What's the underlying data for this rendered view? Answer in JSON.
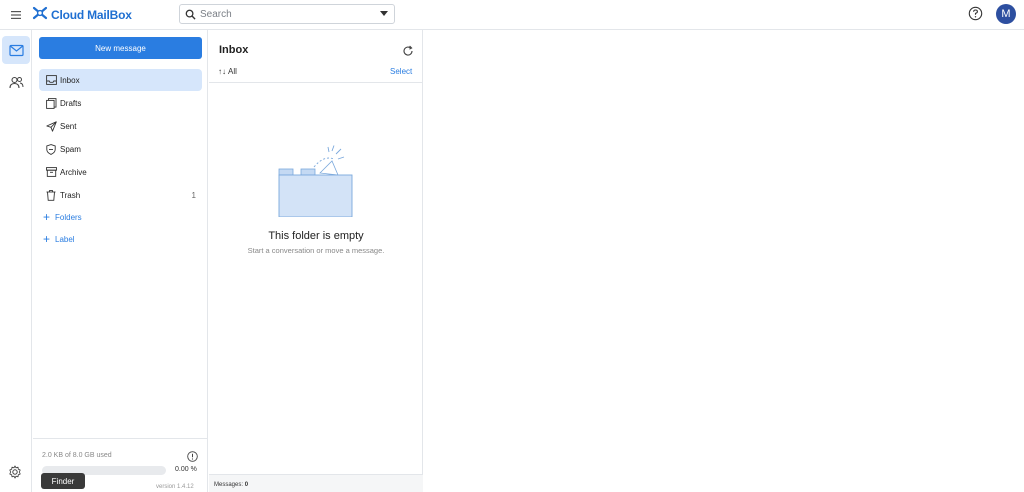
{
  "app": {
    "brand": "Cloud MailBox",
    "accent_color": "#2a7de1",
    "avatar_initial": "M"
  },
  "header": {
    "search_placeholder": "Search",
    "icons": [
      "menu-icon",
      "search-icon",
      "chevron-down-icon",
      "help-icon"
    ]
  },
  "rail": {
    "items": [
      {
        "name": "mail",
        "icon": "envelope-icon",
        "active": true
      },
      {
        "name": "contacts",
        "icon": "people-icon",
        "active": false
      }
    ]
  },
  "sidebar": {
    "new_message_label": "New message",
    "folders": [
      {
        "label": "Inbox",
        "icon": "inbox-icon",
        "count": "",
        "active": true
      },
      {
        "label": "Drafts",
        "icon": "drafts-icon",
        "count": ""
      },
      {
        "label": "Sent",
        "icon": "send-icon",
        "count": ""
      },
      {
        "label": "Spam",
        "icon": "shield-icon",
        "count": ""
      },
      {
        "label": "Archive",
        "icon": "archive-icon",
        "count": ""
      },
      {
        "label": "Trash",
        "icon": "trash-icon",
        "count": "1"
      }
    ],
    "add_folders_label": "Folders",
    "add_label_label": "Label",
    "storage": {
      "used_text": "2.0 KB of 8.0 GB used",
      "percent_text": "0.00 %",
      "percent_value": 0.0,
      "version_text": "version 1.4.12"
    }
  },
  "list": {
    "title": "Inbox",
    "filter_label": "All",
    "select_label": "Select",
    "empty_title": "This folder is empty",
    "empty_subtitle": "Start a conversation or move a message.",
    "messages_label": "Messages:",
    "messages_count": "0"
  },
  "tooltip": {
    "text": "Finder"
  }
}
